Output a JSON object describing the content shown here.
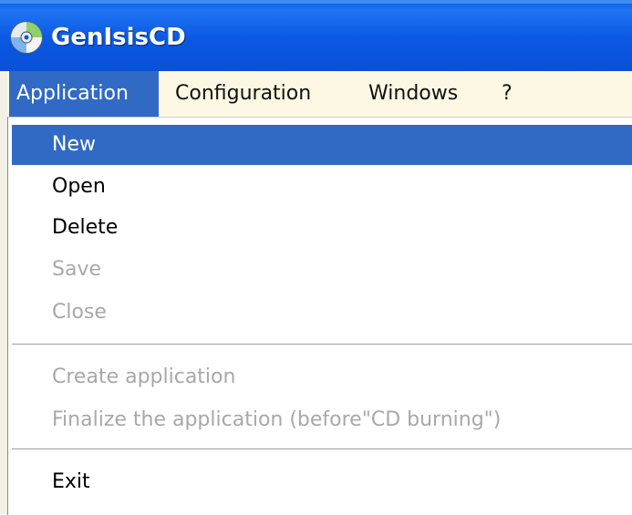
{
  "window": {
    "title": "GenIsisCD",
    "icon": "cd-disc-icon",
    "titlebar_color": "#0b58e2"
  },
  "menubar": {
    "items": [
      {
        "label": "Application",
        "active": true
      },
      {
        "label": "Configuration",
        "active": false
      },
      {
        "label": "Windows",
        "active": false
      },
      {
        "label": "?",
        "active": false
      }
    ],
    "background": "#fdf8e4",
    "highlight_color": "#316ac5"
  },
  "dropdown": {
    "items": [
      {
        "label": "New",
        "state": "highlighted"
      },
      {
        "label": "Open",
        "state": "enabled"
      },
      {
        "label": "Delete",
        "state": "enabled"
      },
      {
        "label": "Save",
        "state": "disabled"
      },
      {
        "label": "Close",
        "state": "disabled"
      },
      {
        "label": "Create application",
        "state": "disabled"
      },
      {
        "label": "Finalize the application (before\"CD burning\")",
        "state": "disabled"
      },
      {
        "label": "Exit",
        "state": "enabled"
      }
    ],
    "disabled_color": "#a8a8a8"
  }
}
